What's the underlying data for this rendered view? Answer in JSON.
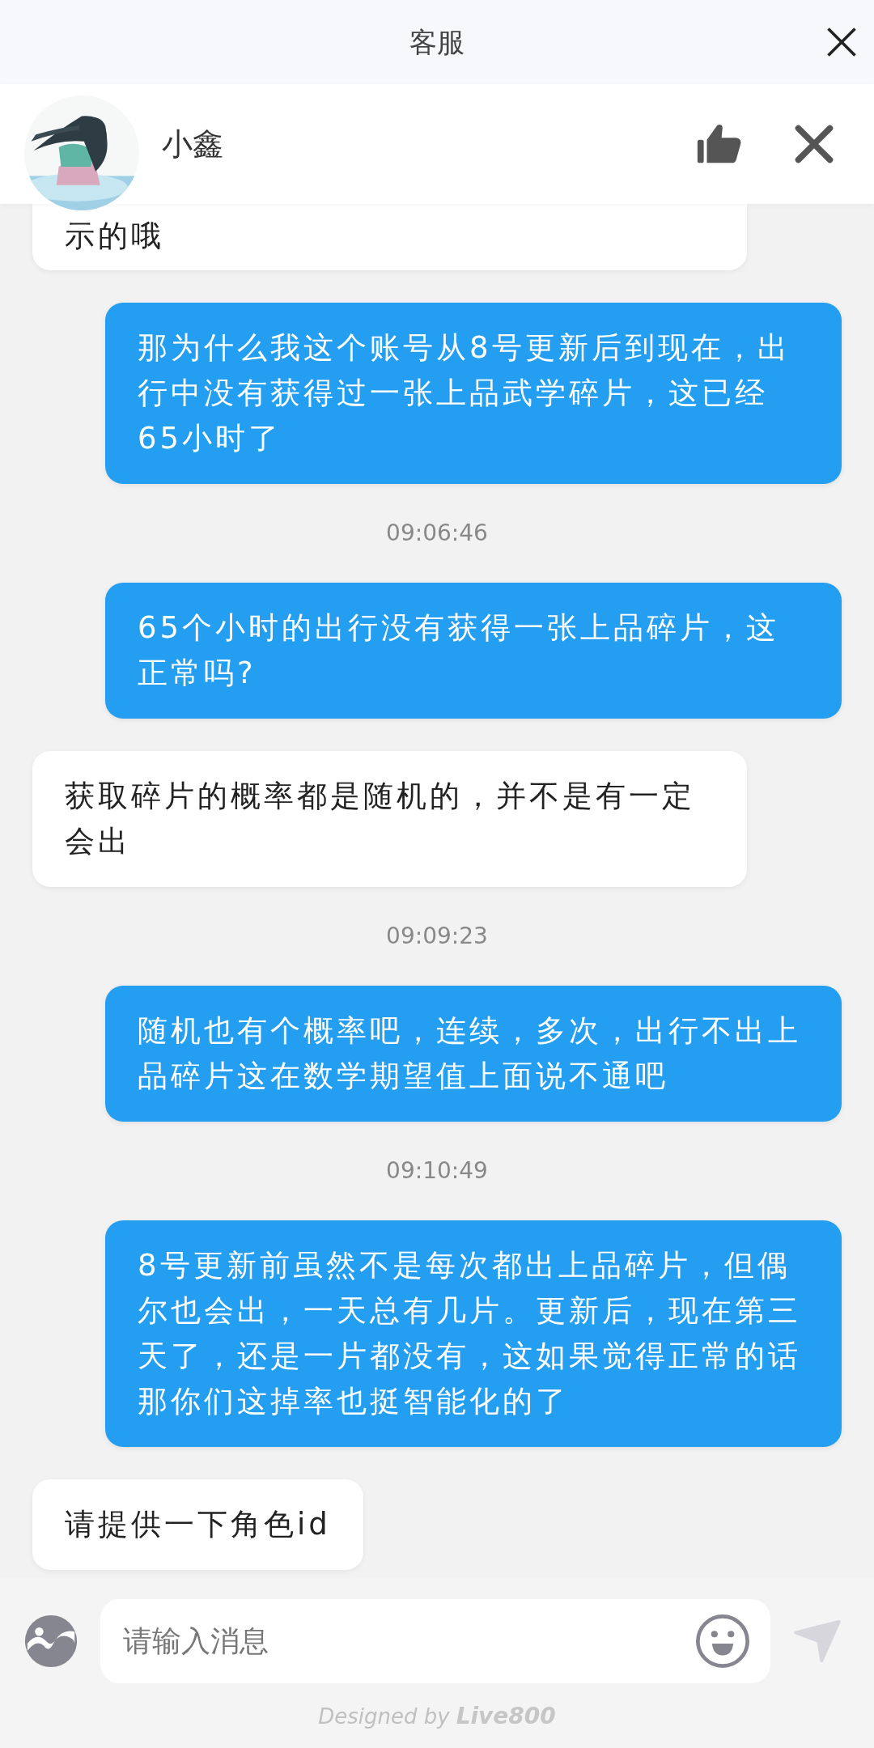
{
  "header": {
    "title": "客服"
  },
  "agent": {
    "name": "小鑫"
  },
  "messages": [
    {
      "kind": "agent",
      "text": "示的哦"
    },
    {
      "kind": "user",
      "text": "那为什么我这个账号从8号更新后到现在，出行中没有获得过一张上品武学碎片，这已经65小时了"
    },
    {
      "kind": "time",
      "text": "09:06:46"
    },
    {
      "kind": "user",
      "text": "65个小时的出行没有获得一张上品碎片，这正常吗?"
    },
    {
      "kind": "agent",
      "text": "获取碎片的概率都是随机的，并不是有一定会出"
    },
    {
      "kind": "time",
      "text": "09:09:23"
    },
    {
      "kind": "user",
      "text": "随机也有个概率吧，连续，多次，出行不出上品碎片这在数学期望值上面说不通吧"
    },
    {
      "kind": "time",
      "text": "09:10:49"
    },
    {
      "kind": "user",
      "text": "8号更新前虽然不是每次都出上品碎片，但偶尔也会出，一天总有几片。更新后，现在第三天了，还是一片都没有，这如果觉得正常的话那你们这掉率也挺智能化的了"
    },
    {
      "kind": "agent",
      "text": "请提供一下角色id"
    }
  ],
  "input": {
    "placeholder": "请输入消息"
  },
  "footer": {
    "prefix": "Designed by",
    "brand": "Live800"
  }
}
